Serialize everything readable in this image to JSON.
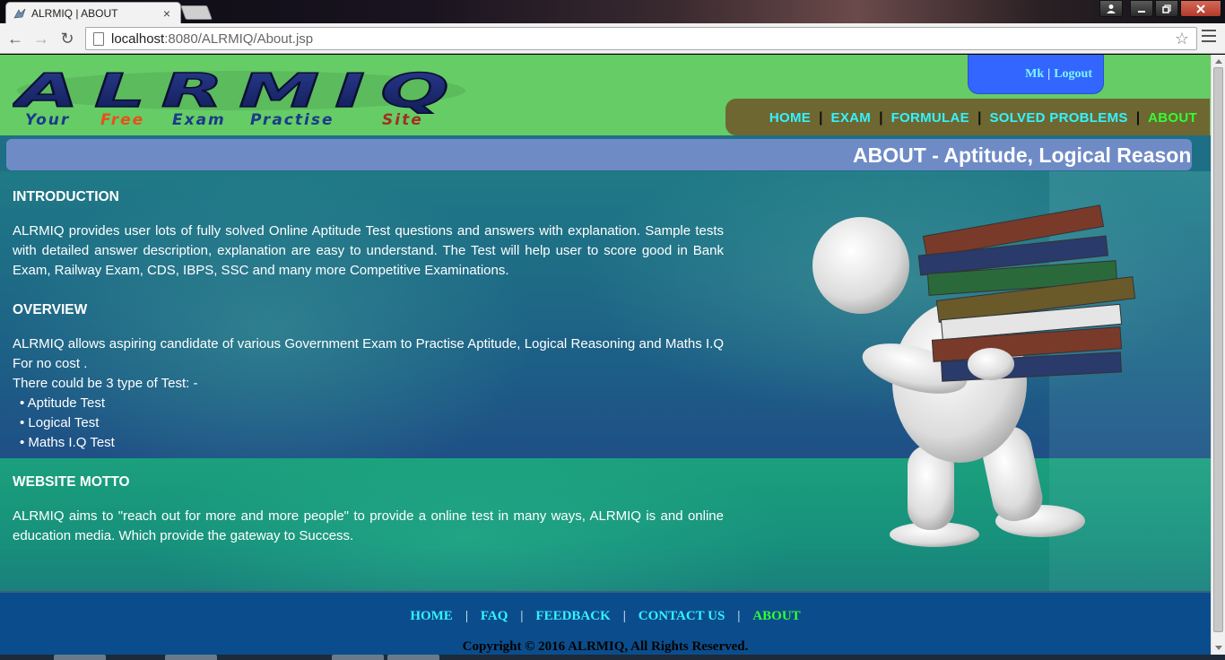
{
  "browser": {
    "tab_title": "ALRMIQ | ABOUT",
    "tab_close": "×",
    "url_host": "localhost",
    "url_rest": ":8080/ALRMIQ/About.jsp",
    "star": "☆",
    "back": "←",
    "forward": "→",
    "reload": "↻"
  },
  "header": {
    "logo_text": "ALRMIQ",
    "tagline_your": "Your",
    "tagline_free": "Free",
    "tagline_exam": "Exam",
    "tagline_practise": "Practise",
    "tagline_site": "Site",
    "user": "Mk",
    "user_sep": "|",
    "logout": "Logout"
  },
  "nav": {
    "items": [
      {
        "label": "HOME"
      },
      {
        "label": "EXAM"
      },
      {
        "label": "FORMULAE"
      },
      {
        "label": "SOLVED PROBLEMS"
      },
      {
        "label": "ABOUT"
      }
    ],
    "sep": "|"
  },
  "marquee": "ABOUT - Aptitude, Logical Reasoning",
  "content": {
    "intro_heading": "INTRODUCTION",
    "intro_text": "ALRMIQ provides user lots of fully solved Online Aptitude Test questions and answers with explanation. Sample tests with detailed answer description, explanation are easy to understand. The Test will help user to score good in Bank Exam, Railway Exam, CDS, IBPS, SSC and many more Competitive Examinations.",
    "overview_heading": "OVERVIEW",
    "overview_text": "ALRMIQ allows aspiring candidate of various Government Exam to Practise Aptitude, Logical Reasoning and Maths I.Q For no cost .",
    "types_intro": "There could be 3 type of Test: -",
    "types": [
      "• Aptitude Test",
      "• Logical Test",
      "• Maths I.Q Test"
    ],
    "motto_heading": "WEBSITE MOTTO",
    "motto_text": "ALRMIQ aims to \"reach out for more and more people\" to provide a online test in many ways, ALRMIQ is and online education media. Which provide the gateway to Success."
  },
  "footer": {
    "links": [
      {
        "label": "HOME"
      },
      {
        "label": "FAQ"
      },
      {
        "label": "FEEDBACK"
      },
      {
        "label": "CONTACT US"
      },
      {
        "label": "ABOUT"
      }
    ],
    "sep": "|",
    "copyright": "Copyright © 2016 ALRMIQ, All Rights Reserved."
  },
  "colors": {
    "header_bg": "#66cc66",
    "nav_bg": "#6e6732",
    "nav_link": "#33f3ff",
    "nav_active": "#33ff33",
    "user_box": "#3366ff",
    "marquee_bg": "#6f8bc6",
    "footer_bg": "#0b4d8c"
  }
}
